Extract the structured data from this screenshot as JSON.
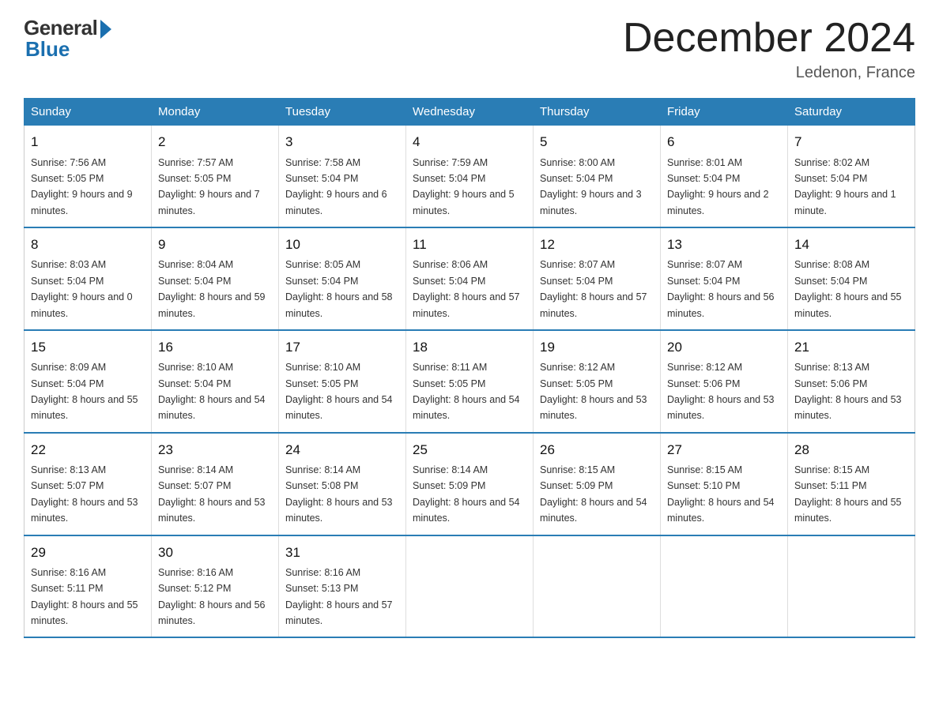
{
  "logo": {
    "general": "General",
    "blue": "Blue"
  },
  "title": "December 2024",
  "location": "Ledenon, France",
  "days_of_week": [
    "Sunday",
    "Monday",
    "Tuesday",
    "Wednesday",
    "Thursday",
    "Friday",
    "Saturday"
  ],
  "weeks": [
    [
      {
        "day": "1",
        "sunrise": "7:56 AM",
        "sunset": "5:05 PM",
        "daylight": "9 hours and 9 minutes."
      },
      {
        "day": "2",
        "sunrise": "7:57 AM",
        "sunset": "5:05 PM",
        "daylight": "9 hours and 7 minutes."
      },
      {
        "day": "3",
        "sunrise": "7:58 AM",
        "sunset": "5:04 PM",
        "daylight": "9 hours and 6 minutes."
      },
      {
        "day": "4",
        "sunrise": "7:59 AM",
        "sunset": "5:04 PM",
        "daylight": "9 hours and 5 minutes."
      },
      {
        "day": "5",
        "sunrise": "8:00 AM",
        "sunset": "5:04 PM",
        "daylight": "9 hours and 3 minutes."
      },
      {
        "day": "6",
        "sunrise": "8:01 AM",
        "sunset": "5:04 PM",
        "daylight": "9 hours and 2 minutes."
      },
      {
        "day": "7",
        "sunrise": "8:02 AM",
        "sunset": "5:04 PM",
        "daylight": "9 hours and 1 minute."
      }
    ],
    [
      {
        "day": "8",
        "sunrise": "8:03 AM",
        "sunset": "5:04 PM",
        "daylight": "9 hours and 0 minutes."
      },
      {
        "day": "9",
        "sunrise": "8:04 AM",
        "sunset": "5:04 PM",
        "daylight": "8 hours and 59 minutes."
      },
      {
        "day": "10",
        "sunrise": "8:05 AM",
        "sunset": "5:04 PM",
        "daylight": "8 hours and 58 minutes."
      },
      {
        "day": "11",
        "sunrise": "8:06 AM",
        "sunset": "5:04 PM",
        "daylight": "8 hours and 57 minutes."
      },
      {
        "day": "12",
        "sunrise": "8:07 AM",
        "sunset": "5:04 PM",
        "daylight": "8 hours and 57 minutes."
      },
      {
        "day": "13",
        "sunrise": "8:07 AM",
        "sunset": "5:04 PM",
        "daylight": "8 hours and 56 minutes."
      },
      {
        "day": "14",
        "sunrise": "8:08 AM",
        "sunset": "5:04 PM",
        "daylight": "8 hours and 55 minutes."
      }
    ],
    [
      {
        "day": "15",
        "sunrise": "8:09 AM",
        "sunset": "5:04 PM",
        "daylight": "8 hours and 55 minutes."
      },
      {
        "day": "16",
        "sunrise": "8:10 AM",
        "sunset": "5:04 PM",
        "daylight": "8 hours and 54 minutes."
      },
      {
        "day": "17",
        "sunrise": "8:10 AM",
        "sunset": "5:05 PM",
        "daylight": "8 hours and 54 minutes."
      },
      {
        "day": "18",
        "sunrise": "8:11 AM",
        "sunset": "5:05 PM",
        "daylight": "8 hours and 54 minutes."
      },
      {
        "day": "19",
        "sunrise": "8:12 AM",
        "sunset": "5:05 PM",
        "daylight": "8 hours and 53 minutes."
      },
      {
        "day": "20",
        "sunrise": "8:12 AM",
        "sunset": "5:06 PM",
        "daylight": "8 hours and 53 minutes."
      },
      {
        "day": "21",
        "sunrise": "8:13 AM",
        "sunset": "5:06 PM",
        "daylight": "8 hours and 53 minutes."
      }
    ],
    [
      {
        "day": "22",
        "sunrise": "8:13 AM",
        "sunset": "5:07 PM",
        "daylight": "8 hours and 53 minutes."
      },
      {
        "day": "23",
        "sunrise": "8:14 AM",
        "sunset": "5:07 PM",
        "daylight": "8 hours and 53 minutes."
      },
      {
        "day": "24",
        "sunrise": "8:14 AM",
        "sunset": "5:08 PM",
        "daylight": "8 hours and 53 minutes."
      },
      {
        "day": "25",
        "sunrise": "8:14 AM",
        "sunset": "5:09 PM",
        "daylight": "8 hours and 54 minutes."
      },
      {
        "day": "26",
        "sunrise": "8:15 AM",
        "sunset": "5:09 PM",
        "daylight": "8 hours and 54 minutes."
      },
      {
        "day": "27",
        "sunrise": "8:15 AM",
        "sunset": "5:10 PM",
        "daylight": "8 hours and 54 minutes."
      },
      {
        "day": "28",
        "sunrise": "8:15 AM",
        "sunset": "5:11 PM",
        "daylight": "8 hours and 55 minutes."
      }
    ],
    [
      {
        "day": "29",
        "sunrise": "8:16 AM",
        "sunset": "5:11 PM",
        "daylight": "8 hours and 55 minutes."
      },
      {
        "day": "30",
        "sunrise": "8:16 AM",
        "sunset": "5:12 PM",
        "daylight": "8 hours and 56 minutes."
      },
      {
        "day": "31",
        "sunrise": "8:16 AM",
        "sunset": "5:13 PM",
        "daylight": "8 hours and 57 minutes."
      },
      null,
      null,
      null,
      null
    ]
  ]
}
